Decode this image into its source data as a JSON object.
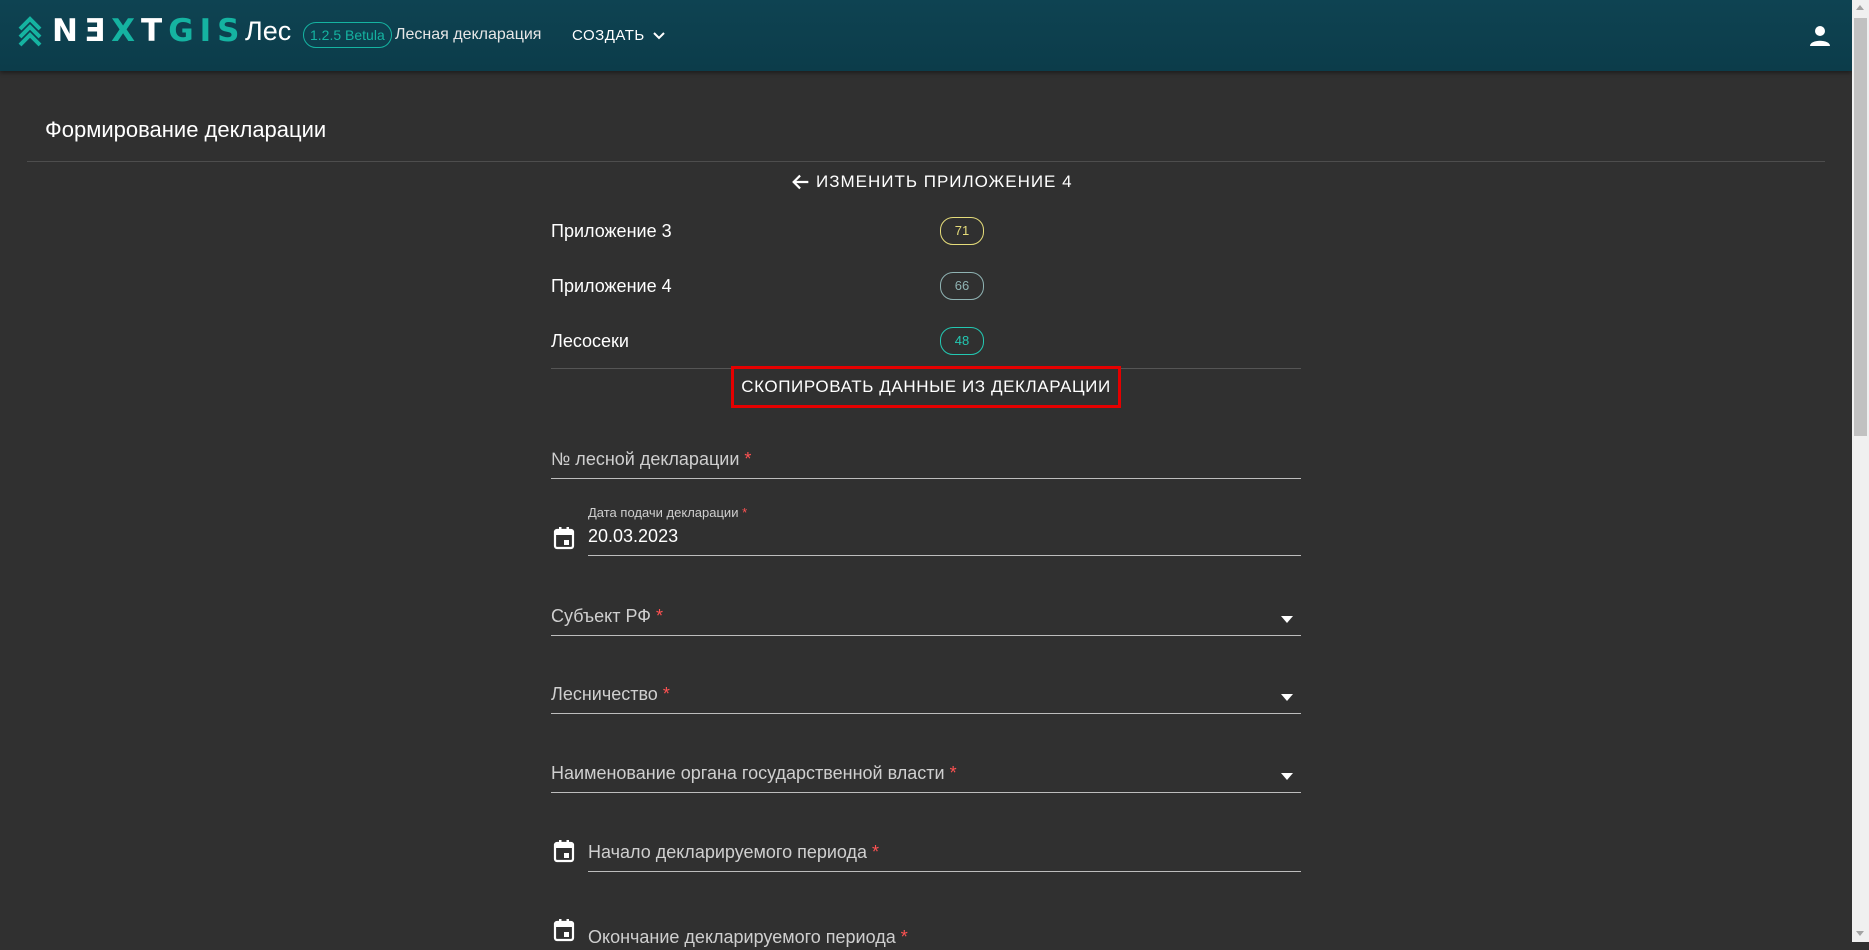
{
  "header": {
    "logo_text": "NEXTGIS",
    "app_title": "Лес",
    "version": "1.2.5 Betula",
    "page_link": "Лесная декларация",
    "create_label": "СОЗДАТЬ"
  },
  "page": {
    "title": "Формирование декларации",
    "back_label": "ИЗМЕНИТЬ ПРИЛОЖЕНИЕ 4"
  },
  "stats": [
    {
      "label": "Приложение 3",
      "count": "71",
      "color": "#e5dc7a"
    },
    {
      "label": "Приложение 4",
      "count": "66",
      "color": "#8fb3b3"
    },
    {
      "label": "Лесосеки",
      "count": "48",
      "color": "#23c8b2"
    }
  ],
  "copy_button": "СКОПИРОВАТЬ ДАННЫЕ ИЗ ДЕКЛАРАЦИИ",
  "form": {
    "decl_number": {
      "label": "№ лесной декларации",
      "req": "*"
    },
    "submit_date": {
      "label": "Дата подачи декларации",
      "req": "*",
      "value": "20.03.2023"
    },
    "subject": {
      "label": "Субъект РФ",
      "req": "*"
    },
    "forestry": {
      "label": "Лесничество",
      "req": "*"
    },
    "authority": {
      "label": "Наименование органа государственной власти",
      "req": "*"
    },
    "period_start": {
      "label": "Начало декларируемого периода",
      "req": "*"
    },
    "period_end": {
      "label": "Окончание декларируемого периода",
      "req": "*"
    }
  },
  "colors": {
    "accent": "#15b3a1",
    "header_bg": "#0e4352",
    "highlight": "#e50000",
    "background": "#303030"
  }
}
